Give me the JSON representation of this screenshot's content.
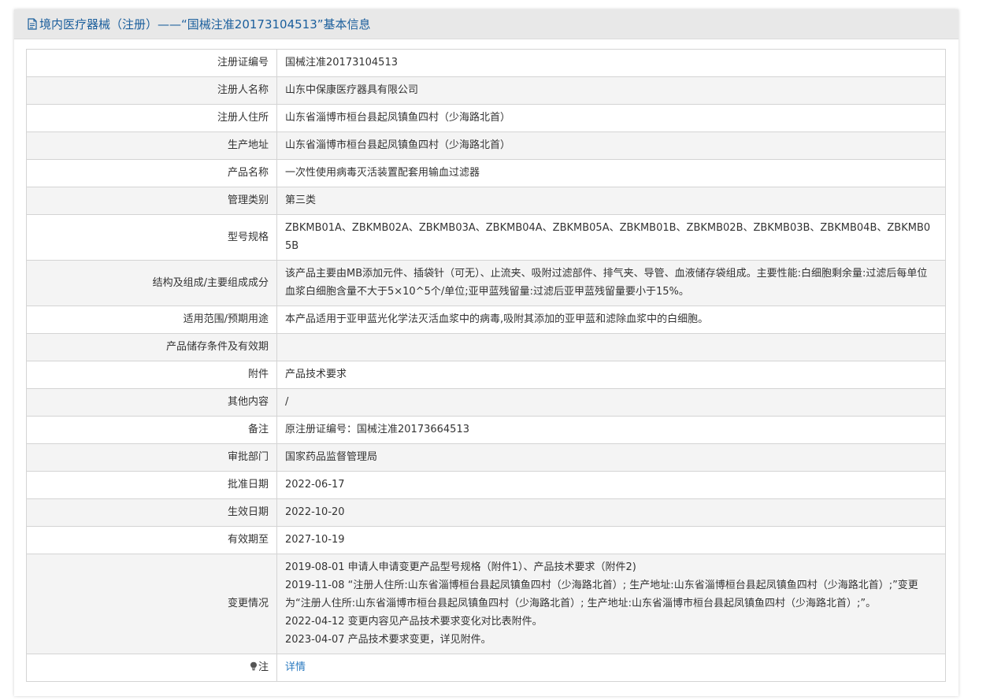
{
  "header": {
    "title": "境内医疗器械（注册）——“国械注准20173104513”基本信息"
  },
  "rows": [
    {
      "label": "注册证编号",
      "value": "国械注准20173104513"
    },
    {
      "label": "注册人名称",
      "value": "山东中保康医疗器具有限公司"
    },
    {
      "label": "注册人住所",
      "value": "山东省淄博市桓台县起凤镇鱼四村（少海路北首）"
    },
    {
      "label": "生产地址",
      "value": "山东省淄博市桓台县起凤镇鱼四村（少海路北首）"
    },
    {
      "label": "产品名称",
      "value": "一次性使用病毒灭活装置配套用输血过滤器"
    },
    {
      "label": "管理类别",
      "value": "第三类"
    },
    {
      "label": "型号规格",
      "value": "ZBKMB01A、ZBKMB02A、ZBKMB03A、ZBKMB04A、ZBKMB05A、ZBKMB01B、ZBKMB02B、ZBKMB03B、ZBKMB04B、ZBKMB05B"
    },
    {
      "label": "结构及组成/主要组成成分",
      "value": "该产品主要由MB添加元件、插袋针（可无）、止流夹、吸附过滤部件、排气夹、导管、血液储存袋组成。主要性能:白细胞剩余量:过滤后每单位血浆白细胞含量不大于5×10^5个/单位;亚甲蓝残留量:过滤后亚甲蓝残留量要小于15%。"
    },
    {
      "label": "适用范围/预期用途",
      "value": "本产品适用于亚甲蓝光化学法灭活血浆中的病毒,吸附其添加的亚甲蓝和滤除血浆中的白细胞。"
    },
    {
      "label": "产品储存条件及有效期",
      "value": ""
    },
    {
      "label": "附件",
      "value": "产品技术要求"
    },
    {
      "label": "其他内容",
      "value": "/"
    },
    {
      "label": "备注",
      "value": "原注册证编号：国械注准20173664513"
    },
    {
      "label": "审批部门",
      "value": "国家药品监督管理局"
    },
    {
      "label": "批准日期",
      "value": "2022-06-17"
    },
    {
      "label": "生效日期",
      "value": "2022-10-20"
    },
    {
      "label": "有效期至",
      "value": "2027-10-19"
    }
  ],
  "changes": {
    "label": "变更情况",
    "lines": [
      "2019-08-01 申请人申请变更产品型号规格（附件1）、产品技术要求（附件2)",
      "2019-11-08 “注册人住所:山东省淄博桓台县起凤镇鱼四村（少海路北首）; 生产地址:山东省淄博桓台县起凤镇鱼四村（少海路北首）;”变更为“注册人住所:山东省淄博市桓台县起凤镇鱼四村（少海路北首）; 生产地址:山东省淄博市桓台县起凤镇鱼四村（少海路北首）;”。",
      "2022-04-12 变更内容见产品技术要求变化对比表附件。",
      "2023-04-07 产品技术要求变更，详见附件。"
    ]
  },
  "note": {
    "label": "注",
    "icon": "lightbulb-icon",
    "link": "详情",
    "link_color": "#2a7ac0"
  },
  "colors": {
    "header_text": "#1a5e9c",
    "header_bg": "#e8e8e8",
    "row_alt_bg": "#f4f4f4",
    "border": "#d4d4d4"
  }
}
